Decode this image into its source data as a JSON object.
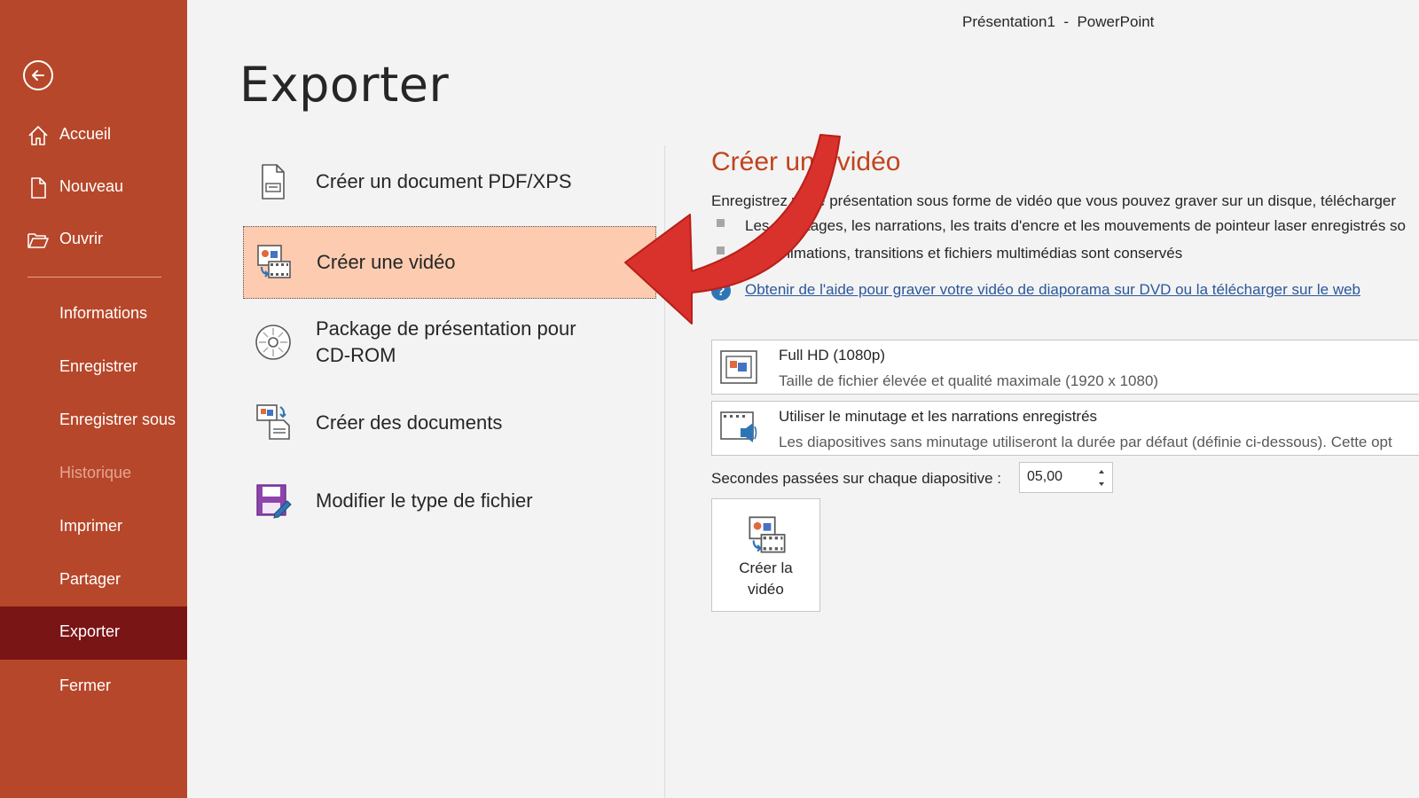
{
  "window": {
    "title": "Présentation1  -  PowerPoint"
  },
  "sidebar": {
    "top_items": [
      {
        "label": "Accueil"
      },
      {
        "label": "Nouveau"
      },
      {
        "label": "Ouvrir"
      }
    ],
    "bottom_items": [
      {
        "label": "Informations"
      },
      {
        "label": "Enregistrer"
      },
      {
        "label": "Enregistrer sous"
      },
      {
        "label": "Historique",
        "disabled": true
      },
      {
        "label": "Imprimer"
      },
      {
        "label": "Partager"
      },
      {
        "label": "Exporter",
        "active": true
      },
      {
        "label": "Fermer"
      }
    ]
  },
  "page": {
    "title": "Exporter"
  },
  "export_options": [
    {
      "label": "Créer un document PDF/XPS",
      "icon": "pdf-document-icon"
    },
    {
      "label": "Créer une vidéo",
      "icon": "video-slide-icon",
      "selected": true
    },
    {
      "label_line1": "Package de présentation pour",
      "label_line2": "CD-ROM",
      "icon": "cd-rom-icon"
    },
    {
      "label": "Créer des documents",
      "icon": "handouts-icon"
    },
    {
      "label": "Modifier le type de fichier",
      "icon": "change-file-type-icon"
    }
  ],
  "panel": {
    "heading": "Créer une vidéo",
    "description": "Enregistrez votre présentation sous forme de vidéo que vous pouvez graver sur un disque, télécharger",
    "bullets": [
      "Les minutages, les narrations, les traits d'encre et les mouvements de pointeur laser enregistrés so",
      "Les animations, transitions et fichiers multimédias sont conservés"
    ],
    "help_link": "Obtenir de l'aide pour graver votre vidéo de diaporama sur DVD ou la télécharger sur le web",
    "quality": {
      "title": "Full HD (1080p)",
      "description": "Taille de fichier élevée et qualité maximale (1920 x 1080)"
    },
    "timing": {
      "title": "Utiliser le minutage et les narrations enregistrés",
      "description": "Les diapositives sans minutage utiliseront la durée par défaut (définie ci-dessous). Cette opt"
    },
    "seconds_label": "Secondes passées sur chaque diapositive :",
    "seconds_value": "05,00",
    "create_button": {
      "line1": "Créer la",
      "line2": "vidéo"
    }
  },
  "colors": {
    "sidebar": "#b7472a",
    "sidebar_active": "#7a1515",
    "selected_option": "#fccbb0",
    "heading": "#c2431d",
    "annotation_arrow": "#d9312b"
  }
}
